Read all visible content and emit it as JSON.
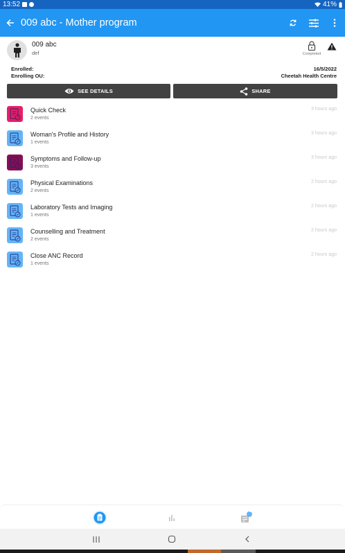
{
  "status_bar": {
    "time": "13:52",
    "battery": "41%"
  },
  "toolbar": {
    "title": "009 abc - Mother program"
  },
  "profile": {
    "name": "009 abc",
    "subtitle": "def",
    "status": "Completed"
  },
  "enrollment": {
    "enrolled_label": "Enrolled:",
    "enrolled_value": "16/5/2022",
    "ou_label": "Enrolling OU:",
    "ou_value": "Cheetah Health Centre"
  },
  "actions": {
    "see_details": "SEE DETAILS",
    "share": "SHARE"
  },
  "stages": [
    {
      "title": "Quick Check",
      "count": "2 events",
      "time": "3 hours ago",
      "color": "#e91e63"
    },
    {
      "title": "Woman's Profile and History",
      "count": "1 events",
      "time": "3 hours ago",
      "color": "#64b5f6"
    },
    {
      "title": "Symptoms and Follow-up",
      "count": "3 events",
      "time": "3 hours ago",
      "color": "#880e4f"
    },
    {
      "title": "Physical Examinations",
      "count": "2 events",
      "time": "2 hours ago",
      "color": "#64b5f6"
    },
    {
      "title": "Laboratory Tests and Imaging",
      "count": "1 events",
      "time": "2 hours ago",
      "color": "#64b5f6"
    },
    {
      "title": "Counselling and Treatment",
      "count": "2 events",
      "time": "2 hours ago",
      "color": "#64b5f6"
    },
    {
      "title": "Close ANC Record",
      "count": "1 events",
      "time": "2 hours ago",
      "color": "#64b5f6"
    }
  ],
  "bottom_nav": {
    "notes_badge": "1"
  },
  "colors": {
    "primary": "#2196f3",
    "status_bar": "#1565c0",
    "button": "#424242"
  }
}
